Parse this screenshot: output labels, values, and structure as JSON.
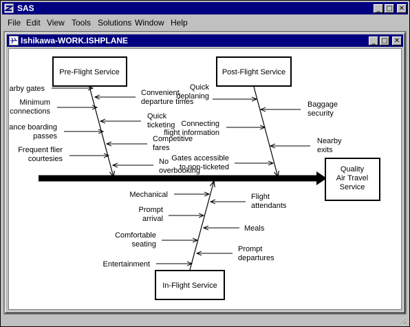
{
  "app": {
    "title": "SAS"
  },
  "window_controls": {
    "minimize": "_",
    "maximize": "□",
    "close": "✕"
  },
  "menu": [
    "File",
    "Edit",
    "View",
    "Tools",
    "Solutions",
    "Window",
    "Help"
  ],
  "child_window": {
    "title": "Ishikawa-WORK.ISHPLANE"
  },
  "diagram": {
    "effect": [
      "Quality",
      "Air Travel",
      "Service"
    ],
    "categories": {
      "pre_flight": "Pre-Flight Service",
      "post_flight": "Post-Flight Service",
      "in_flight": "In-Flight Service"
    },
    "pre_flight_causes": [
      [
        "Nearby gates"
      ],
      [
        "Minimum",
        "connections"
      ],
      [
        "Advance boarding",
        "passes"
      ],
      [
        "Frequent flier",
        "courtesies"
      ],
      [
        "Convenient",
        "departure times"
      ],
      [
        "Quick",
        "ticketing"
      ],
      [
        "Competitive",
        "fares"
      ],
      [
        "No",
        "overbooking"
      ]
    ],
    "post_flight_causes": [
      [
        "Quick",
        "deplaning"
      ],
      [
        "Connecting",
        "flight information"
      ],
      [
        "Gates accessible",
        "to non-ticketed"
      ],
      [
        "Baggage",
        "security"
      ],
      [
        "Nearby",
        "exits"
      ]
    ],
    "in_flight_causes": [
      [
        "Mechanical"
      ],
      [
        "Prompt",
        "arrival"
      ],
      [
        "Comfortable",
        "seating"
      ],
      [
        "Entertainment"
      ],
      [
        "Flight",
        "attendants"
      ],
      [
        "Meals"
      ],
      [
        "Prompt",
        "departures"
      ]
    ]
  }
}
